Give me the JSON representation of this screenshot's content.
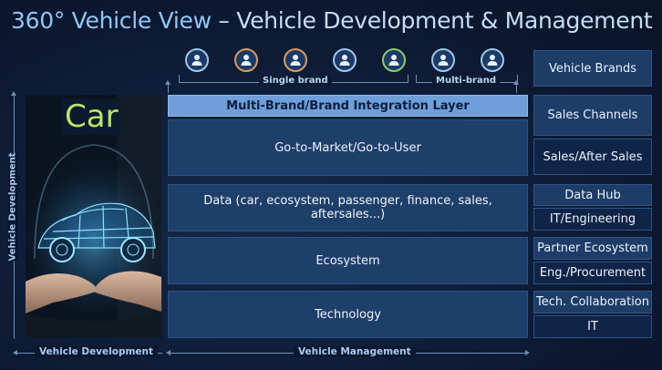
{
  "title": {
    "accent": "360° Vehicle View",
    "rest": " – Vehicle Development & Management"
  },
  "brands": {
    "single_label": "Single brand",
    "multi_label": "Multi-brand",
    "icons": [
      {
        "name": "person-icon",
        "ring": "#9fc7ea"
      },
      {
        "name": "person-icon",
        "ring": "#d99a5a"
      },
      {
        "name": "person-icon",
        "ring": "#d99a5a"
      },
      {
        "name": "person-icon",
        "ring": "#9fc7ea"
      },
      {
        "name": "person-icon",
        "ring": "#8fc96a"
      },
      {
        "name": "person-icon",
        "ring": "#9fc7ea"
      },
      {
        "name": "person-icon",
        "ring": "#9fc7ea"
      }
    ]
  },
  "layers": {
    "integration": "Multi-Brand/Brand Integration Layer",
    "gtm": "Go-to-Market/Go-to-User",
    "data": "Data (car, ecosystem, passenger, finance, sales, aftersales...)",
    "ecosystem": "Ecosystem",
    "technology": "Technology"
  },
  "right": {
    "vehicle_brands": "Vehicle Brands",
    "sales_channels": "Sales Channels",
    "sales_after_sales": "Sales/After Sales",
    "data_hub": "Data Hub",
    "it_engineering": "IT/Engineering",
    "partner_ecosystem": "Partner Ecosystem",
    "eng_procurement": "Eng./Procurement",
    "tech_collaboration": "Tech. Collaboration",
    "it": "IT"
  },
  "photo": {
    "label": "Car"
  },
  "axes": {
    "vertical": "Vehicle Development",
    "bottom_left": "Vehicle Development",
    "bottom_right": "Vehicle Management"
  },
  "colors": {
    "background": "#0d1b33",
    "layer": "#1f3f6b",
    "integration": "#6f9fd8",
    "car_label": "#b9e36a"
  }
}
